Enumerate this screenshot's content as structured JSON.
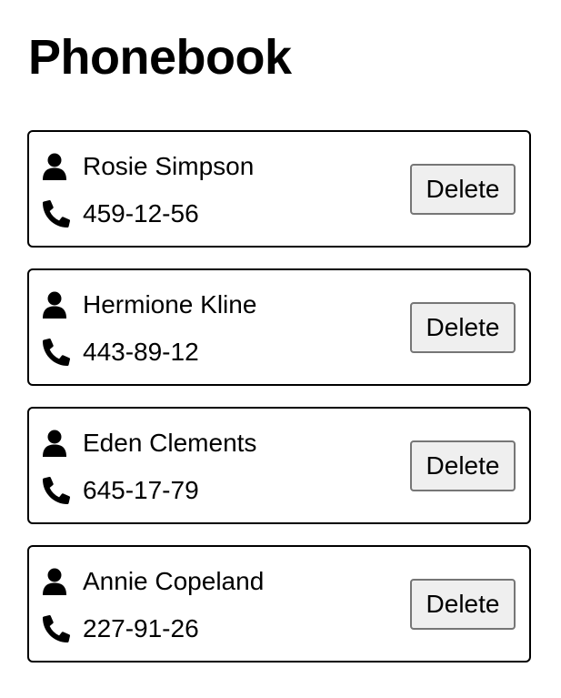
{
  "page": {
    "title": "Phonebook"
  },
  "contacts": [
    {
      "name": "Rosie Simpson",
      "number": "459-12-56",
      "delete_label": "Delete"
    },
    {
      "name": "Hermione Kline",
      "number": "443-89-12",
      "delete_label": "Delete"
    },
    {
      "name": "Eden Clements",
      "number": "645-17-79",
      "delete_label": "Delete"
    },
    {
      "name": "Annie Copeland",
      "number": "227-91-26",
      "delete_label": "Delete"
    }
  ],
  "icons": {
    "person": "user-icon",
    "phone": "phone-icon"
  },
  "colors": {
    "text": "#000000",
    "card_border": "#000000",
    "button_bg": "#efefef",
    "button_border": "#767676"
  }
}
